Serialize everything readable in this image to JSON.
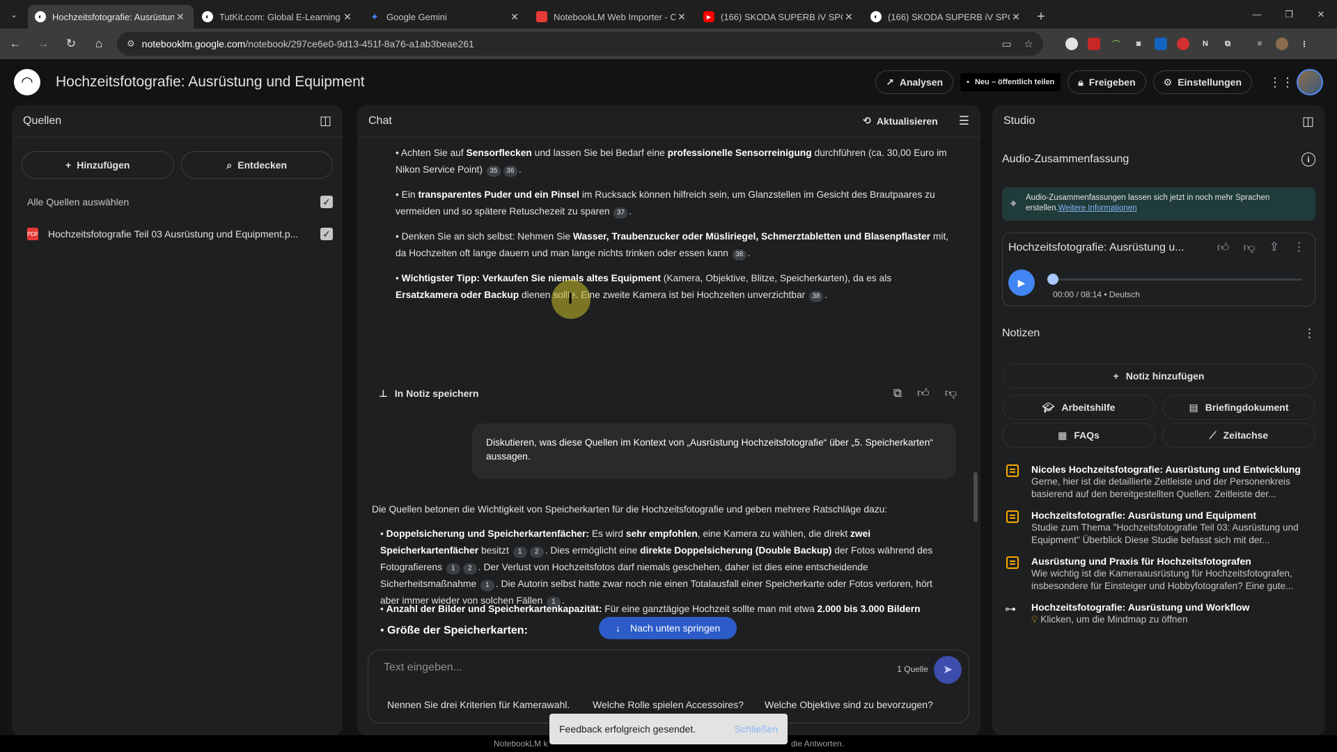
{
  "browser": {
    "tabs": [
      {
        "title": "Hochzeitsfotografie: Ausrüstung",
        "active": true,
        "favicon_color": "#ffffff"
      },
      {
        "title": "TutKit.com: Global E-Learning F",
        "active": false,
        "favicon_color": "#ffffff"
      },
      {
        "title": "Google Gemini",
        "active": false,
        "favicon_color": "#4285f4"
      },
      {
        "title": "NotebookLM Web Importer - C",
        "active": false,
        "favicon_color": "#e53935"
      },
      {
        "title": "(166) SKODA SUPERB iV SPORT",
        "active": false,
        "favicon_color": "#ff0000"
      },
      {
        "title": "(166) SKODA SUPERB iV SPORT",
        "active": false,
        "favicon_color": "#ffffff"
      }
    ],
    "url_domain": "notebooklm.google.com",
    "url_path": "/notebook/297ce6e0-9d13-451f-8a76-a1ab3beae261"
  },
  "app": {
    "title": "Hochzeitsfotografie: Ausrüstung und Equipment",
    "analysen": "Analysen",
    "share_public": "Neu – öffentlich teilen",
    "freigeben": "Freigeben",
    "einstellungen": "Einstellungen"
  },
  "sources": {
    "title": "Quellen",
    "add": "Hinzufügen",
    "discover": "Entdecken",
    "select_all": "Alle Quellen auswählen",
    "items": [
      {
        "name": "Hochzeitsfotografie Teil 03 Ausrüstung und Equipment.p..."
      }
    ]
  },
  "chat": {
    "title": "Chat",
    "refresh": "Aktualisieren",
    "save_note": "In Notiz speichern",
    "user_question": "Diskutieren, was diese Quellen im Kontext von „Ausrüstung Hochzeitsfotografie“ über „5. Speicherkarten“ aussagen.",
    "answer_intro": "Die Quellen betonen die Wichtigkeit von Speicherkarten für die Hochzeitsfotografie und geben mehrere Ratschläge dazu:",
    "jump_down": "Nach unten springen",
    "input_placeholder": "Text eingeben...",
    "source_count": "1 Quelle",
    "suggestions": [
      "Nennen Sie drei Kriterien für Kamerawahl.",
      "Welche Rolle spielen Accessoires?",
      "Welche Objektive sind zu bevorzugen?"
    ]
  },
  "studio": {
    "title": "Studio",
    "audio_heading": "Audio-Zusammenfassung",
    "banner_text": "Audio-Zusammenfassungen lassen sich jetzt in noch mehr Sprachen erstellen.",
    "banner_link": "Weitere Informationen",
    "audio_title": "Hochzeitsfotografie: Ausrüstung u...",
    "audio_meta": "00:00 / 08:14 • Deutsch",
    "audio_progress": 0,
    "notes_heading": "Notizen",
    "add_note": "Notiz hinzufügen",
    "study_guide": "Arbeitshilfe",
    "briefing": "Briefingdokument",
    "faqs": "FAQs",
    "timeline": "Zeitachse",
    "notes": [
      {
        "title": "Nicoles Hochzeitsfotografie: Ausrüstung und Entwicklung",
        "text": "Gerne, hier ist die detaillierte Zeitleiste und der Personenkreis basierend auf den bereitgestellten Quellen: Zeitleiste der..."
      },
      {
        "title": "Hochzeitsfotografie: Ausrüstung und Equipment",
        "text": "Studie zum Thema \"Hochzeitsfotografie Teil 03: Ausrüstung und Equipment\" Überblick Diese Studie befasst sich mit der..."
      },
      {
        "title": "Ausrüstung und Praxis für Hochzeitsfotografen",
        "text": "Wie wichtig ist die Kameraausrüstung für Hochzeitsfotografen, insbesondere für Einsteiger und Hobbyfotografen? Eine gute..."
      },
      {
        "title": "Hochzeitsfotografie: Ausrüstung und Workflow",
        "text": "Klicken, um die Mindmap zu öffnen"
      }
    ]
  },
  "toast": {
    "message": "Feedback erfolgreich gesendet.",
    "close": "Schließen"
  },
  "footer": {
    "left": "NotebookLM k",
    "right": "die Antworten."
  }
}
